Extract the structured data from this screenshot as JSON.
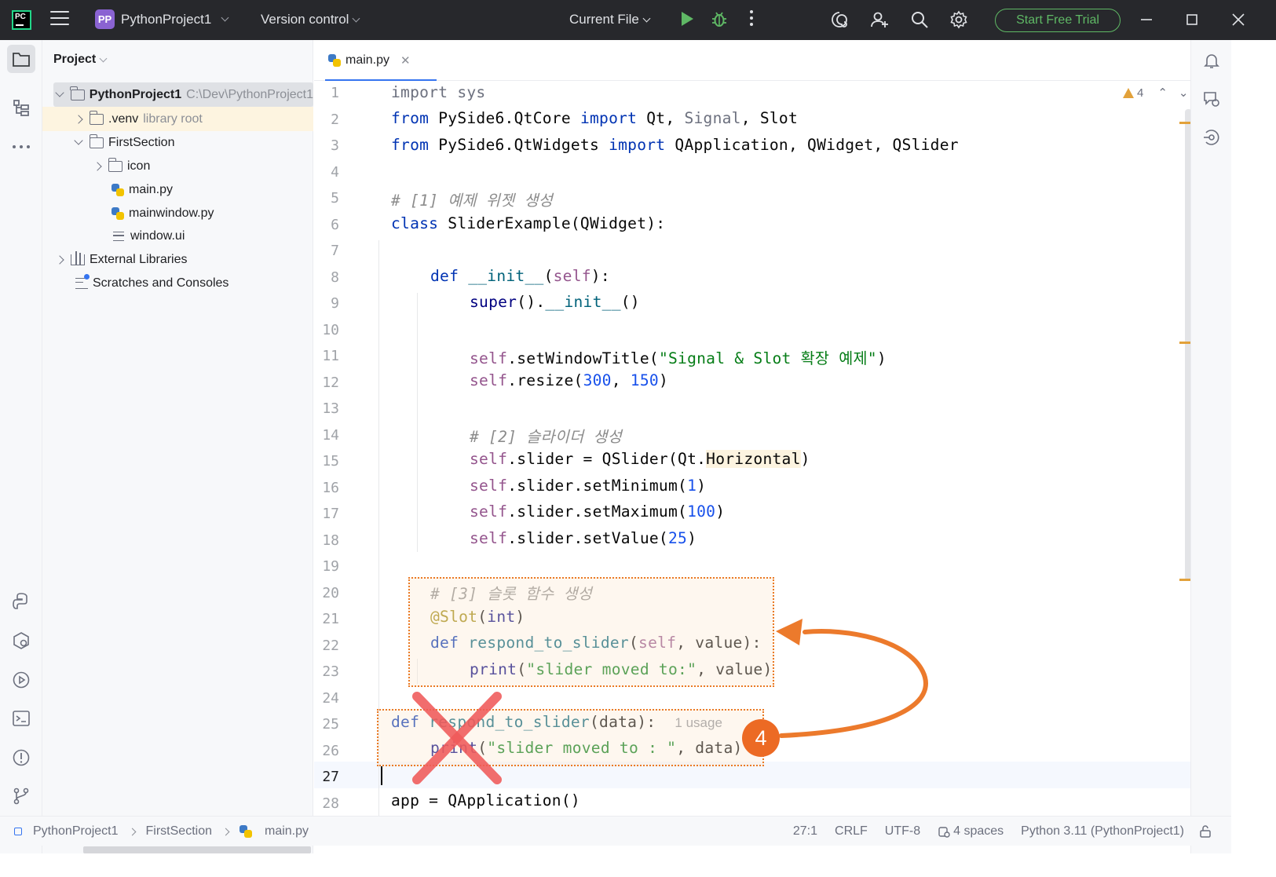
{
  "titlebar": {
    "logo_text": "PC",
    "project_badge": "PP",
    "project_name": "PythonProject1",
    "vcs_label": "Version control",
    "run_config": "Current File",
    "trial_label": "Start Free Trial",
    "accent_color": "#5fb865"
  },
  "project_panel": {
    "title": "Project",
    "tree": [
      {
        "label": "PythonProject1",
        "hint": "C:\\Dev\\PythonProject1"
      },
      {
        "label": ".venv",
        "hint": "library root"
      },
      {
        "label": "FirstSection"
      },
      {
        "label": "icon"
      },
      {
        "label": "main.py"
      },
      {
        "label": "mainwindow.py"
      },
      {
        "label": "window.ui"
      },
      {
        "label": "External Libraries"
      },
      {
        "label": "Scratches and Consoles"
      }
    ]
  },
  "editor": {
    "tab_label": "main.py",
    "warning_count": "4",
    "line_numbers": [
      "1",
      "2",
      "3",
      "4",
      "5",
      "6",
      "7",
      "8",
      "9",
      "10",
      "11",
      "12",
      "13",
      "14",
      "15",
      "16",
      "17",
      "18",
      "19",
      "20",
      "21",
      "22",
      "23",
      "24",
      "25",
      "26",
      "27",
      "28"
    ],
    "code": {
      "l1": "import sys",
      "l2": "from PySide6.QtCore import Qt, Signal, Slot",
      "l3": "from PySide6.QtWidgets import QApplication, QWidget, QSlider",
      "l5": "# [1] 예제 위젯 생성",
      "l6": "class SliderExample(QWidget):",
      "l8": "def __init__(self):",
      "l9": "super().__init__()",
      "l11_title": "\"Signal & Slot 확장 예제\"",
      "l12_w": "300",
      "l12_h": "150",
      "l14": "# [2] 슬라이더 생성",
      "l15_attr": "Horizontal",
      "l16_val": "1",
      "l17_val": "100",
      "l18_val": "25",
      "l20": "# [3] 슬롯 함수 생성",
      "l21": "@Slot",
      "l21_arg": "int",
      "l22_fn": "respond_to_slider",
      "l23_str": "\"slider moved to:\"",
      "l25_fn": "respond_to_slider",
      "l25_usage": "1 usage",
      "l26_str": "\"slider moved to : \"",
      "l28": "app = QApplication()"
    }
  },
  "annotation": {
    "badge": "4",
    "color": "#ec6a24",
    "cross_color": "#f05a5a"
  },
  "statusbar": {
    "crumbs": [
      "PythonProject1",
      "FirstSection",
      "main.py"
    ],
    "position": "27:1",
    "line_sep": "CRLF",
    "encoding": "UTF-8",
    "indent": "4 spaces",
    "interpreter": "Python 3.11 (PythonProject1)"
  }
}
